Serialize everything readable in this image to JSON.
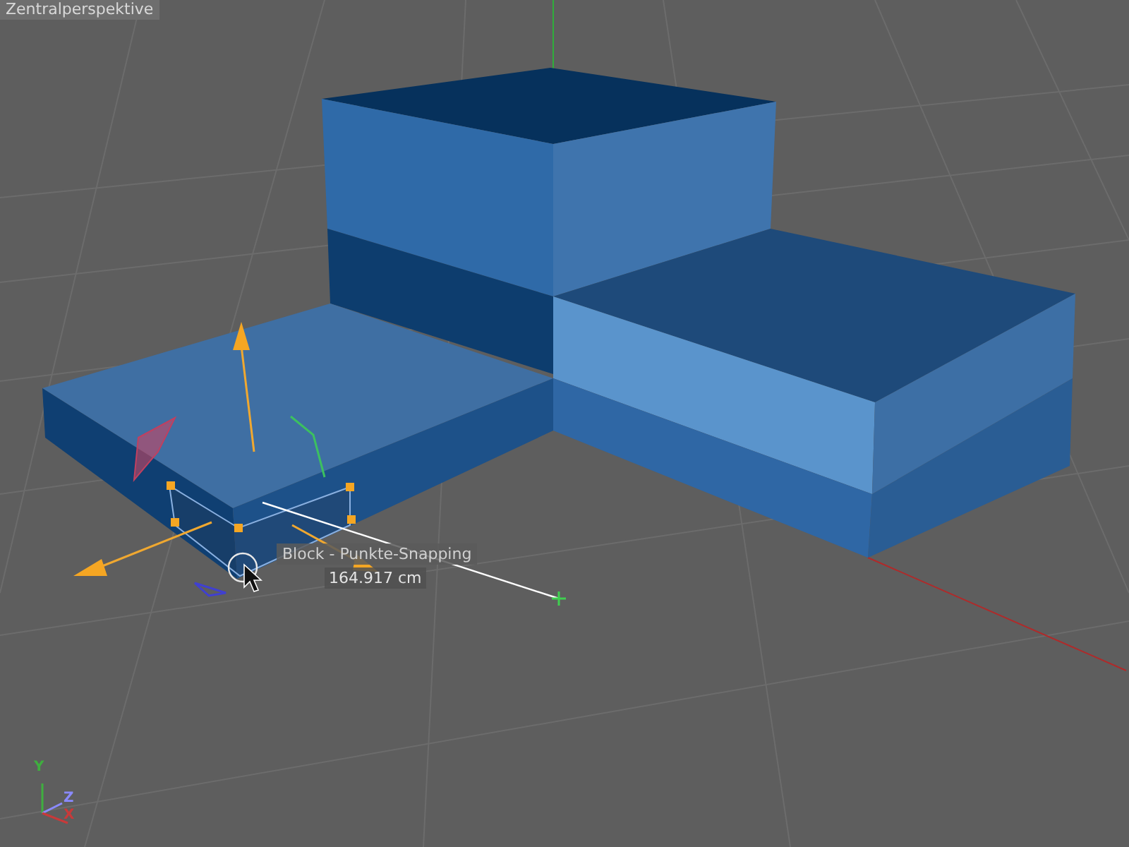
{
  "viewport": {
    "title": "Zentralperspektive"
  },
  "snap_tooltip": {
    "title": "Block - Punkte-Snapping",
    "measurement": "164.917 cm"
  },
  "axes": [
    {
      "label": "Y",
      "color": "#3fae3f"
    },
    {
      "label": "Z",
      "color": "#8a8aff"
    },
    {
      "label": "X",
      "color": "#c83a3a"
    }
  ]
}
